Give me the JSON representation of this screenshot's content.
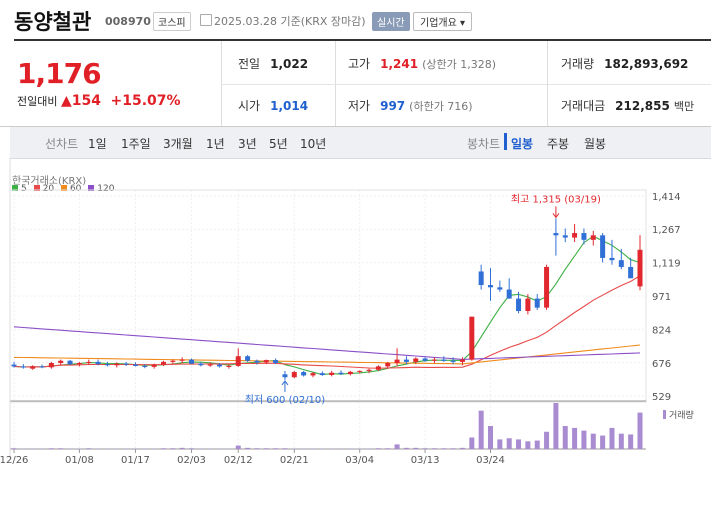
{
  "header": {
    "name": "동양철관",
    "code": "008970",
    "market": "코스피",
    "date": "2025.03.28 기준(KRX 장마감)",
    "realtime": "실시간",
    "corp_info": "기업개요 ▾"
  },
  "summary": {
    "price": "1,176",
    "change_label": "전일대비",
    "change": "154",
    "change_pct": "+15.07%",
    "prev_label": "전일",
    "prev": "1,022",
    "open_label": "시가",
    "open": "1,014",
    "high_label": "고가",
    "high": "1,241",
    "upper_limit": "(상한가 1,328)",
    "low_label": "저가",
    "low": "997",
    "lower_limit": "(하한가 716)",
    "volume_label": "거래량",
    "volume": "182,893,692",
    "amount_label": "거래대금",
    "amount": "212,855",
    "amount_unit": "백만"
  },
  "toolbar": {
    "line_label": "선차트",
    "periods": [
      "1일",
      "1주일",
      "3개월",
      "1년",
      "3년",
      "5년",
      "10년"
    ],
    "candle_label": "봉차트",
    "candle_types": [
      "일봉",
      "주봉",
      "월봉"
    ],
    "selected_candle": "일봉"
  },
  "chart_data": {
    "type": "candlestick",
    "source": "한국거래소(KRX)",
    "ma_legend": [
      {
        "name": "5",
        "color": "#3cb043"
      },
      {
        "name": "20",
        "color": "#e84a4a"
      },
      {
        "name": "60",
        "color": "#f08c1e"
      },
      {
        "name": "120",
        "color": "#8b4fc9"
      }
    ],
    "y_ticks": [
      1414,
      1267,
      1119,
      971,
      824,
      676,
      529
    ],
    "ylim": [
      529,
      1414
    ],
    "x_ticks": [
      "12/26",
      "01/08",
      "01/17",
      "02/03",
      "02/12",
      "02/21",
      "03/04",
      "03/13",
      "03/24"
    ],
    "high_annotation": "최고 1,315 (03/19)",
    "low_annotation": "최저 600 (02/10)",
    "volume_label": "거래량",
    "candles": [
      [
        668,
        680,
        655,
        660
      ],
      [
        660,
        670,
        650,
        655
      ],
      [
        650,
        665,
        645,
        660
      ],
      [
        660,
        668,
        652,
        656
      ],
      [
        656,
        680,
        650,
        675
      ],
      [
        675,
        690,
        665,
        685
      ],
      [
        685,
        688,
        665,
        670
      ],
      [
        670,
        680,
        660,
        675
      ],
      [
        675,
        690,
        668,
        680
      ],
      [
        680,
        690,
        665,
        670
      ],
      [
        670,
        680,
        660,
        665
      ],
      [
        665,
        678,
        655,
        672
      ],
      [
        672,
        680,
        662,
        668
      ],
      [
        668,
        678,
        660,
        662
      ],
      [
        662,
        670,
        652,
        658
      ],
      [
        658,
        672,
        650,
        668
      ],
      [
        668,
        685,
        662,
        680
      ],
      [
        680,
        690,
        670,
        685
      ],
      [
        685,
        700,
        675,
        690
      ],
      [
        690,
        695,
        670,
        672
      ],
      [
        672,
        680,
        660,
        665
      ],
      [
        665,
        678,
        658,
        668
      ],
      [
        668,
        675,
        655,
        660
      ],
      [
        660,
        670,
        650,
        662
      ],
      [
        662,
        740,
        658,
        705
      ],
      [
        705,
        710,
        680,
        685
      ],
      [
        685,
        690,
        668,
        678
      ],
      [
        678,
        690,
        670,
        688
      ],
      [
        688,
        695,
        670,
        675
      ],
      [
        625,
        640,
        600,
        612
      ],
      [
        612,
        640,
        608,
        635
      ],
      [
        635,
        640,
        615,
        620
      ],
      [
        620,
        635,
        612,
        630
      ],
      [
        630,
        638,
        618,
        622
      ],
      [
        622,
        640,
        616,
        632
      ],
      [
        632,
        642,
        622,
        626
      ],
      [
        626,
        640,
        620,
        636
      ],
      [
        636,
        642,
        628,
        640
      ],
      [
        640,
        650,
        630,
        645
      ],
      [
        645,
        665,
        640,
        660
      ],
      [
        660,
        680,
        650,
        675
      ],
      [
        675,
        740,
        660,
        690
      ],
      [
        690,
        705,
        670,
        680
      ],
      [
        680,
        700,
        670,
        695
      ],
      [
        695,
        700,
        680,
        685
      ],
      [
        685,
        700,
        675,
        690
      ],
      [
        690,
        705,
        680,
        685
      ],
      [
        685,
        700,
        670,
        680
      ],
      [
        680,
        700,
        665,
        690
      ],
      [
        690,
        880,
        685,
        880
      ],
      [
        1080,
        1110,
        1000,
        1020
      ],
      [
        1020,
        1095,
        950,
        1010
      ],
      [
        1010,
        1040,
        990,
        1000
      ],
      [
        1000,
        1050,
        960,
        960
      ],
      [
        960,
        990,
        895,
        905
      ],
      [
        905,
        980,
        890,
        960
      ],
      [
        960,
        980,
        910,
        920
      ],
      [
        920,
        1110,
        910,
        1100
      ],
      [
        1250,
        1315,
        1150,
        1240
      ],
      [
        1240,
        1270,
        1210,
        1230
      ],
      [
        1230,
        1290,
        1210,
        1250
      ],
      [
        1250,
        1270,
        1200,
        1220
      ],
      [
        1220,
        1260,
        1195,
        1240
      ],
      [
        1240,
        1250,
        1120,
        1140
      ],
      [
        1140,
        1220,
        1110,
        1130
      ],
      [
        1130,
        1180,
        1090,
        1100
      ],
      [
        1100,
        1140,
        1050,
        1050
      ],
      [
        1014,
        1241,
        997,
        1176
      ]
    ],
    "volumes": [
      2,
      1,
      1,
      1,
      2,
      2,
      1,
      1,
      2,
      1,
      1,
      1,
      1,
      1,
      1,
      1,
      2,
      2,
      3,
      2,
      1,
      1,
      1,
      1,
      9,
      3,
      2,
      2,
      2,
      2,
      1,
      1,
      1,
      1,
      1,
      1,
      1,
      1,
      1,
      2,
      2,
      12,
      3,
      3,
      2,
      2,
      2,
      2,
      3,
      30,
      100,
      60,
      25,
      28,
      25,
      20,
      22,
      45,
      120,
      60,
      55,
      48,
      40,
      35,
      55,
      40,
      38,
      95
    ]
  }
}
